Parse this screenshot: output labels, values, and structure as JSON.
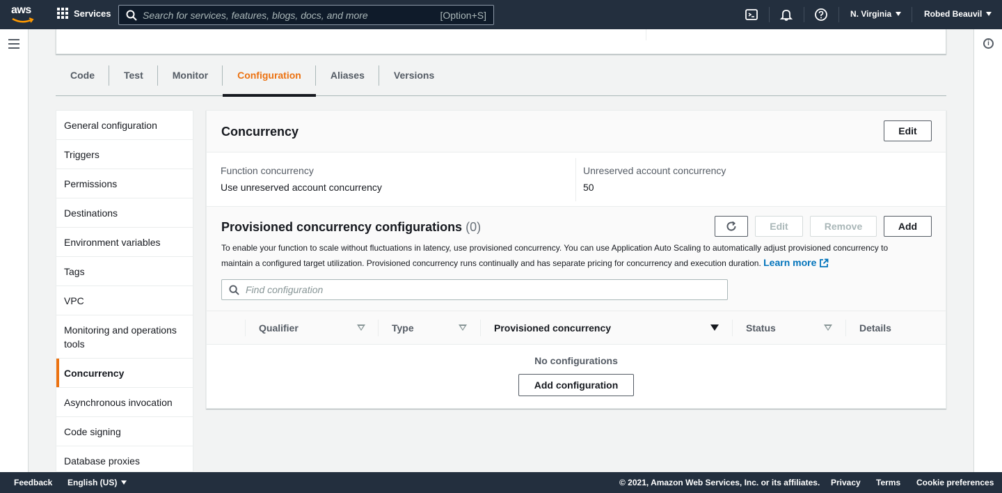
{
  "topnav": {
    "logo_text": "aws",
    "services_label": "Services",
    "search_placeholder": "Search for services, features, blogs, docs, and more",
    "search_shortcut": "[Option+S]",
    "region": "N. Virginia",
    "user": "Robed Beauvil",
    "icons": [
      "cloudshell-icon",
      "bell-icon",
      "help-icon"
    ]
  },
  "tabs": [
    {
      "label": "Code",
      "active": false
    },
    {
      "label": "Test",
      "active": false
    },
    {
      "label": "Monitor",
      "active": false
    },
    {
      "label": "Configuration",
      "active": true
    },
    {
      "label": "Aliases",
      "active": false
    },
    {
      "label": "Versions",
      "active": false
    }
  ],
  "config_nav": [
    {
      "label": "General configuration",
      "active": false
    },
    {
      "label": "Triggers",
      "active": false
    },
    {
      "label": "Permissions",
      "active": false
    },
    {
      "label": "Destinations",
      "active": false
    },
    {
      "label": "Environment variables",
      "active": false
    },
    {
      "label": "Tags",
      "active": false
    },
    {
      "label": "VPC",
      "active": false
    },
    {
      "label": "Monitoring and operations tools",
      "active": false
    },
    {
      "label": "Concurrency",
      "active": true
    },
    {
      "label": "Asynchronous invocation",
      "active": false
    },
    {
      "label": "Code signing",
      "active": false
    },
    {
      "label": "Database proxies",
      "active": false
    }
  ],
  "concurrency": {
    "title": "Concurrency",
    "edit_label": "Edit",
    "function_concurrency_label": "Function concurrency",
    "function_concurrency_value": "Use unreserved account concurrency",
    "unreserved_label": "Unreserved account concurrency",
    "unreserved_value": "50"
  },
  "provisioned": {
    "title": "Provisioned concurrency configurations",
    "count": "(0)",
    "refresh_icon": "refresh-icon",
    "edit_label": "Edit",
    "remove_label": "Remove",
    "add_label": "Add",
    "description": "To enable your function to scale without fluctuations in latency, use provisioned concurrency. You can use Application Auto Scaling to automatically adjust provisioned concurrency to maintain a configured target utilization. Provisioned concurrency runs continually and has separate pricing for concurrency and execution duration.",
    "learn_more": "Learn more",
    "find_placeholder": "Find configuration",
    "columns": [
      "Qualifier",
      "Type",
      "Provisioned concurrency",
      "Status",
      "Details"
    ],
    "empty_text": "No configurations",
    "add_config_label": "Add configuration"
  },
  "footer": {
    "feedback": "Feedback",
    "language": "English (US)",
    "copyright": "© 2021, Amazon Web Services, Inc. or its affiliates.",
    "privacy": "Privacy",
    "terms": "Terms",
    "cookie": "Cookie preferences"
  },
  "colors": {
    "nav_bg": "#232f3e",
    "accent": "#ec7211",
    "link": "#0073bb"
  }
}
